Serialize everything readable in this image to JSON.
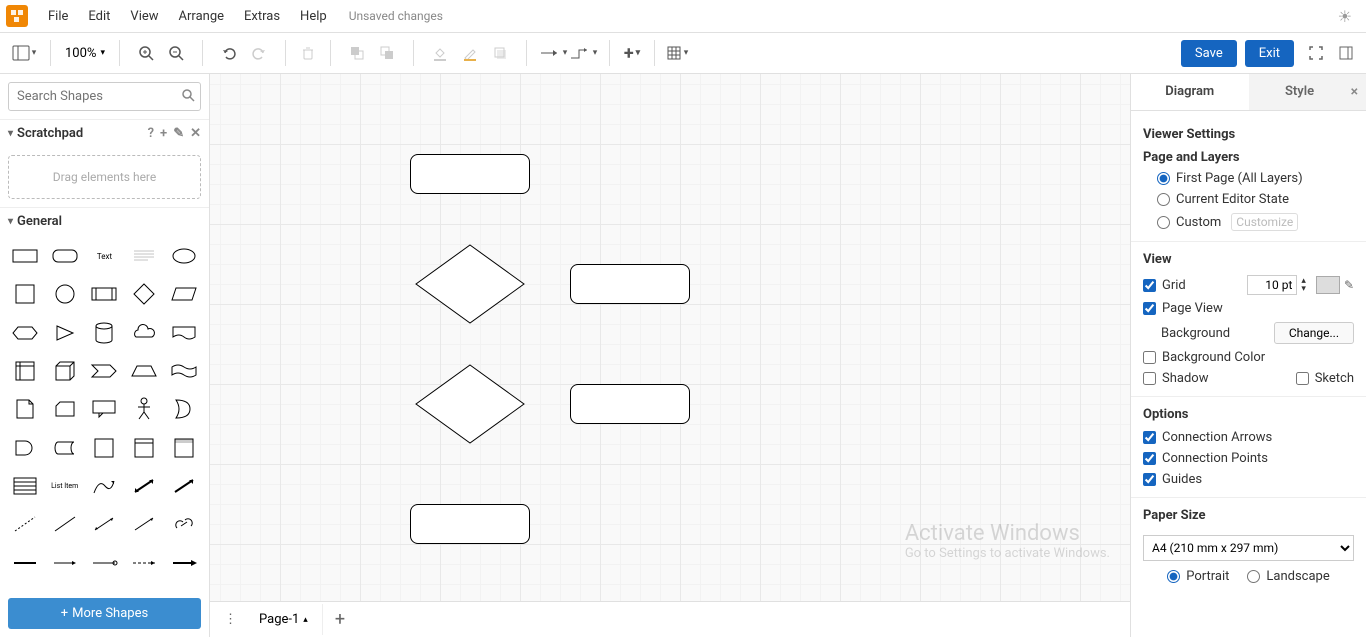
{
  "menubar": {
    "items": [
      "File",
      "Edit",
      "View",
      "Arrange",
      "Extras",
      "Help"
    ],
    "unsaved": "Unsaved changes"
  },
  "toolbar": {
    "zoom": "100%",
    "save": "Save",
    "exit": "Exit"
  },
  "left": {
    "search_placeholder": "Search Shapes",
    "scratchpad": "Scratchpad",
    "scratch_hint": "Drag elements here",
    "general": "General",
    "more_shapes": "More Shapes"
  },
  "tabs": {
    "page1": "Page-1"
  },
  "right": {
    "tab_diagram": "Diagram",
    "tab_style": "Style",
    "viewer_settings": "Viewer Settings",
    "page_and_layers": "Page and Layers",
    "first_page": "First Page (All Layers)",
    "current_editor": "Current Editor State",
    "custom": "Custom",
    "customize": "Customize",
    "view": "View",
    "grid": "Grid",
    "grid_size": "10 pt",
    "page_view": "Page View",
    "background": "Background",
    "change": "Change...",
    "background_color": "Background Color",
    "shadow": "Shadow",
    "sketch": "Sketch",
    "options": "Options",
    "conn_arrows": "Connection Arrows",
    "conn_points": "Connection Points",
    "guides": "Guides",
    "paper_size": "Paper Size",
    "paper_options": [
      "A4 (210 mm x 297 mm)"
    ],
    "paper_value": "A4 (210 mm x 297 mm)",
    "portrait": "Portrait",
    "landscape": "Landscape"
  },
  "watermark": {
    "title": "Activate Windows",
    "sub": "Go to Settings to activate Windows."
  }
}
